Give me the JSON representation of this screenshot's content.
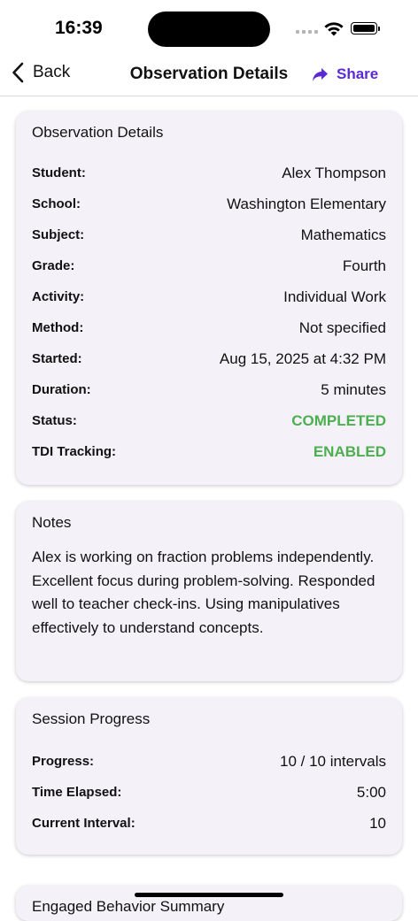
{
  "status_bar": {
    "time": "16:39"
  },
  "nav": {
    "back_label": "Back",
    "title": "Observation Details",
    "share_label": "Share"
  },
  "details_card": {
    "title": "Observation Details",
    "rows": [
      {
        "label": "Student:",
        "value": "Alex Thompson"
      },
      {
        "label": "School:",
        "value": "Washington Elementary"
      },
      {
        "label": "Subject:",
        "value": "Mathematics"
      },
      {
        "label": "Grade:",
        "value": "Fourth"
      },
      {
        "label": "Activity:",
        "value": "Individual Work"
      },
      {
        "label": "Method:",
        "value": "Not specified"
      },
      {
        "label": "Started:",
        "value": "Aug 15, 2025 at 4:32 PM"
      },
      {
        "label": "Duration:",
        "value": "5 minutes"
      },
      {
        "label": "Status:",
        "value": "COMPLETED"
      },
      {
        "label": "TDI Tracking:",
        "value": "ENABLED"
      }
    ]
  },
  "notes_card": {
    "title": "Notes",
    "text": "Alex is working on fraction problems independently. Excellent focus during problem-solving. Responded well to teacher check-ins. Using manipulatives effectively to understand concepts."
  },
  "progress_card": {
    "title": "Session Progress",
    "rows": [
      {
        "label": "Progress:",
        "value": "10 / 10 intervals"
      },
      {
        "label": "Time Elapsed:",
        "value": "5:00"
      },
      {
        "label": "Current Interval:",
        "value": "10"
      }
    ]
  },
  "next_card": {
    "title": "Engaged Behavior Summary"
  },
  "colors": {
    "accent": "#5b2ad6",
    "success": "#4caf50",
    "card_bg": "#f5f1f8"
  }
}
